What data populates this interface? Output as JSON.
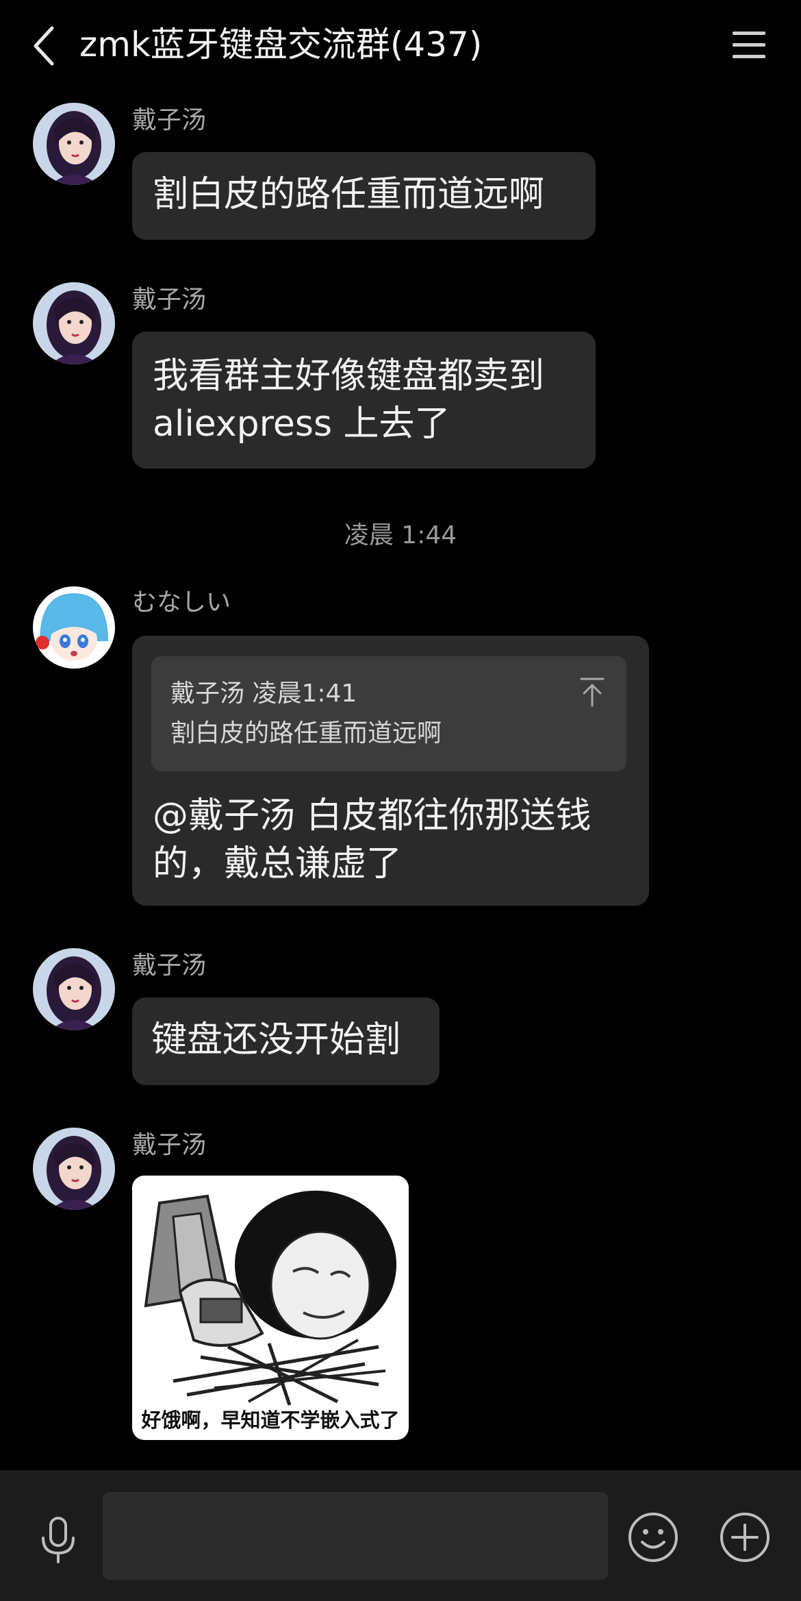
{
  "header": {
    "title": "zmk蓝牙键盘交流群(437)",
    "back_icon": "chevron-left-icon",
    "menu_icon": "hamburger-menu-icon"
  },
  "messages": [
    {
      "sender": "戴子汤",
      "lines": [
        "割白皮的路任重而道远啊"
      ]
    },
    {
      "sender": "戴子汤",
      "lines": [
        "我看群主好像键盘都卖到",
        "aliexpress 上去了"
      ]
    },
    {
      "timestamp": "凌晨 1:44"
    },
    {
      "sender": "むなしい",
      "quote": {
        "meta": "戴子汤  凌晨1:41",
        "text": "割白皮的路任重而道远啊"
      },
      "lines": [
        "@戴子汤 白皮都往你那送钱",
        "的，戴总谦虚了"
      ]
    },
    {
      "sender": "戴子汤",
      "lines": [
        "键盘还没开始割"
      ]
    },
    {
      "sender": "戴子汤",
      "sticker_caption": "好饿啊，早知道不学嵌入式了"
    }
  ],
  "input_bar": {
    "placeholder": "",
    "voice_icon": "microphone-icon",
    "emoji_icon": "smiley-icon",
    "plus_icon": "plus-circle-icon"
  },
  "colors": {
    "background": "#000000",
    "bubble": "#2a2a2a",
    "quote": "#3c3c3c",
    "input_bar": "#1c1c1c"
  }
}
